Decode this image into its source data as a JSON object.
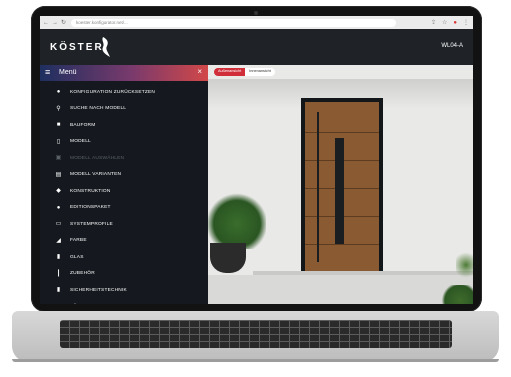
{
  "browser": {
    "url": "koester.konfigurator.net/..."
  },
  "app": {
    "logo_text": "KÖSTER",
    "model_code": "WL04-A"
  },
  "scene": {
    "toggle": {
      "active": "Außenansicht",
      "inactive": "Innenansicht"
    }
  },
  "menu": {
    "title": "Menü",
    "items": [
      {
        "label": "KONFIGURATION ZURÜCKSETZEN",
        "icon": "●",
        "disabled": false
      },
      {
        "label": "SUCHE NACH MODELL",
        "icon": "⚲",
        "disabled": false
      },
      {
        "label": "BAUFORM",
        "icon": "■",
        "disabled": false
      },
      {
        "label": "MODELL",
        "icon": "▯",
        "disabled": false
      },
      {
        "label": "MODELL AUSWÄHLEN",
        "icon": "▣",
        "disabled": true
      },
      {
        "label": "MODELL VARIANTEN",
        "icon": "▤",
        "disabled": false
      },
      {
        "label": "KONSTRUKTION",
        "icon": "◆",
        "disabled": false
      },
      {
        "label": "EDITIONSPAKET",
        "icon": "●",
        "disabled": false
      },
      {
        "label": "SYSTEMPROFILE",
        "icon": "▭",
        "disabled": false
      },
      {
        "label": "FARBE",
        "icon": "◢",
        "disabled": false
      },
      {
        "label": "GLAS",
        "icon": "▮",
        "disabled": false
      },
      {
        "label": "ZUBEHÖR",
        "icon": "┃",
        "disabled": false
      },
      {
        "label": "SICHERHEITSTECHNIK",
        "icon": "▮",
        "disabled": false
      },
      {
        "label": "TÜR INS HAUS EINSETZEN",
        "icon": "▲",
        "disabled": false
      }
    ]
  },
  "colors": {
    "menu_bg": "#15191f",
    "accent_red": "#d02f3a",
    "door_wood": "#8a5a33"
  }
}
